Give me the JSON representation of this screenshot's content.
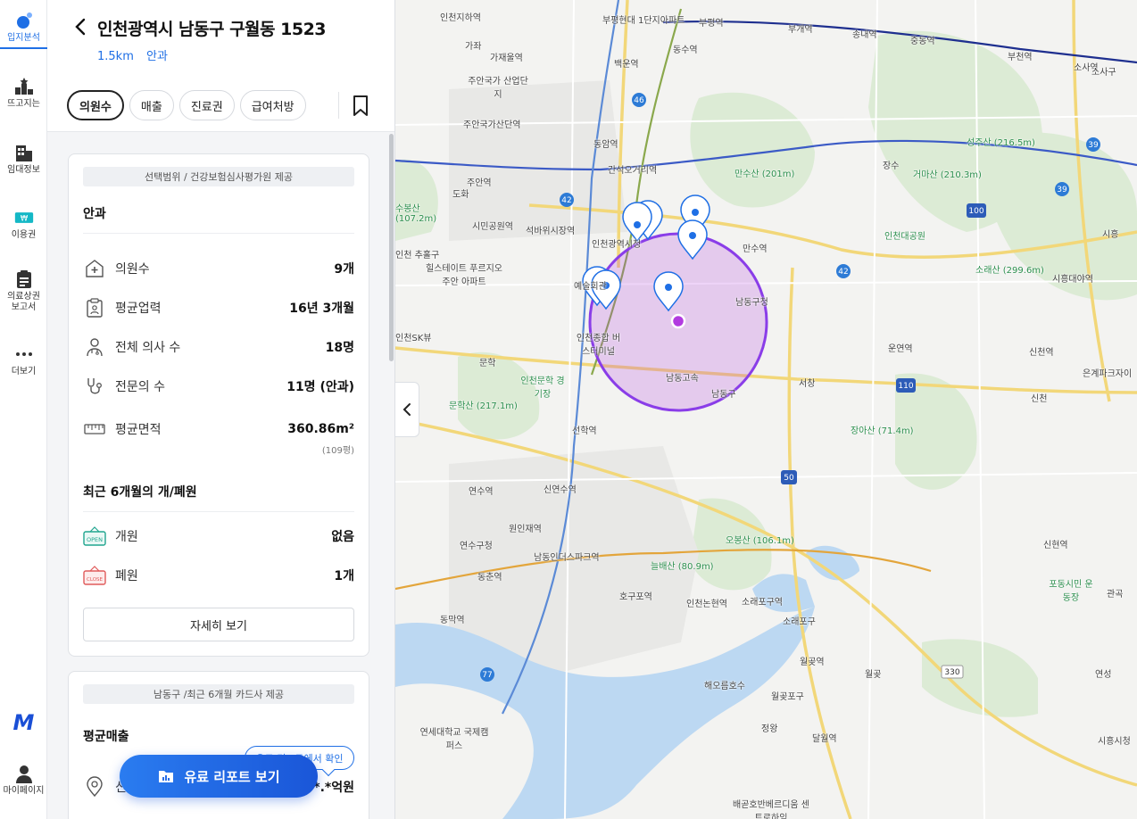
{
  "rail": {
    "items": [
      {
        "label": "입지분석",
        "icon": "location-analysis-icon"
      },
      {
        "label": "뜨고지는",
        "icon": "ranking-icon"
      },
      {
        "label": "임대정보",
        "icon": "building-icon"
      },
      {
        "label": "이용권",
        "icon": "ticket-icon"
      },
      {
        "label": "의료상권\n보고서",
        "icon": "report-icon"
      },
      {
        "label": "더보기",
        "icon": "more-icon"
      }
    ],
    "logo": "M",
    "mypage": "마이페이지"
  },
  "panel": {
    "address": "인천광역시 남동구 구월동 1523",
    "radius": "1.5km",
    "specialty": "안과",
    "chips": [
      "의원수",
      "매출",
      "진료권",
      "급여처방"
    ],
    "active_chip": "의원수"
  },
  "card1": {
    "source": "선택범위 / 건강보험심사평가원 제공",
    "title": "안과",
    "rows": [
      {
        "label": "의원수",
        "value": "9개",
        "icon": "clinic-plus-icon"
      },
      {
        "label": "평균업력",
        "value": "16년 3개월",
        "icon": "clipboard-icon"
      },
      {
        "label": "전체 의사 수",
        "value": "18명",
        "icon": "doctor-icon"
      },
      {
        "label": "전문의 수",
        "value": "11명 (안과)",
        "icon": "stethoscope-icon"
      },
      {
        "label": "평균면적",
        "value": "360.86m²",
        "sub": "(109평)",
        "icon": "ruler-icon"
      }
    ],
    "openclose_title": "최근 6개월의 개/폐원",
    "open": {
      "label": "개원",
      "value": "없음",
      "icon": "open-sign-icon",
      "sign": "OPEN"
    },
    "close": {
      "label": "폐원",
      "value": "1개",
      "icon": "close-sign-icon",
      "sign": "CLOSE"
    },
    "detail_button": "자세히 보기"
  },
  "card2": {
    "source": "남동구 /최근 6개월 카드사 제공",
    "title": "평균매출",
    "value_partial": "*.*억원",
    "label_partial": "신"
  },
  "cta": {
    "label": "유료 리포트 보기",
    "tooltip": "유료 리포트에서 확인"
  },
  "colors": {
    "accent": "#1f6fe5",
    "circle": "#8a3de8",
    "center_dot": "#b23be0"
  },
  "map": {
    "labels": [
      "인천지하역",
      "부평현대 1단지아파트",
      "부평역",
      "부개역",
      "송내역",
      "중동역",
      "부천역",
      "소사역",
      "소사구",
      "가좌",
      "가재울역",
      "주안국가 산업단지",
      "주안국가산단역",
      "동수역",
      "백운역",
      "동암역",
      "간석오거리역",
      "주안역",
      "도화",
      "시민공원역",
      "석바위시장역",
      "인천광역시청",
      "만수역",
      "남동구청",
      "만수산 (201m)",
      "성주산 (216.5m)",
      "거마산 (210.3m)",
      "인천대공원",
      "장수",
      "소래산 (299.6m)",
      "시흥대야역",
      "시흥",
      "힐스테이트 푸르지오주안 아파트",
      "예술회관",
      "인천종합 버스터미널",
      "인천문학 경기장",
      "문학",
      "문학산 (217.1m)",
      "선학역",
      "남동고속",
      "남동구",
      "서창",
      "운연역",
      "장아산 (71.4m)",
      "신천역",
      "은계파크자이",
      "신천",
      "연수역",
      "신연수역",
      "원인재역",
      "연수구청",
      "동춘역",
      "남동인더스파크역",
      "동막역",
      "오봉산 (106.1m)",
      "늘배산 (80.9m)",
      "호구포역",
      "인천논현역",
      "소래포구역",
      "소래포구",
      "해오름호수",
      "월곶역",
      "월곶포구",
      "월곶",
      "연성",
      "신현역",
      "포동시민 운동장",
      "정왕",
      "달월역",
      "연세대학교 국제캠퍼스",
      "배곧호반베르디움 센트로하임",
      "수봉산 (107.2m)",
      "인천 추홀구",
      "인천SK뷰",
      "주안국가",
      "시흥시청",
      "관곡"
    ],
    "route_numbers": [
      "46",
      "42",
      "42",
      "39",
      "39",
      "100",
      "110",
      "50",
      "77",
      "330"
    ]
  }
}
